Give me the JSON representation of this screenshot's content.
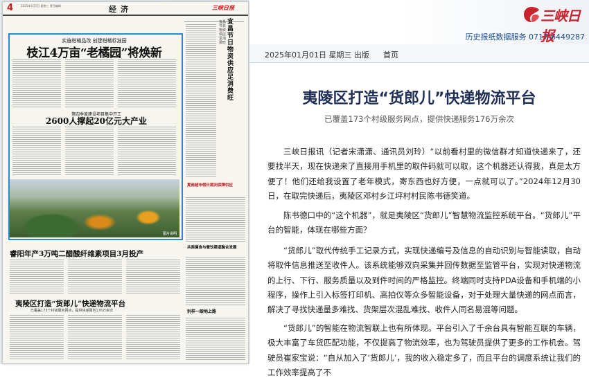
{
  "paper": {
    "page_number": "4",
    "page_meta": "2025年1月1日 星期三 责任编辑",
    "section": "经济",
    "brand": "三峡日报",
    "story_a_kicker": "实施柑橘品改 创建柑橘标准园",
    "story_a_headline": "枝江4万亩“老橘园”将焕新",
    "story_b_kicker": "第四季度建设项目集中开工",
    "story_b_headline": "2600人撑起20亿元大产业",
    "photo_caption": "图片说明",
    "story_c_headline": "睿阳年产3万吨二醋酸纤维素项目3月投产",
    "story_d_headline": "夷陵区打造“货郎儿”快递物流平台",
    "story_d_sub": "已覆盖173个村级服务网点，提供快递服务176万余次",
    "story_e_kicker": "宜昌节日物资供应足消费旺",
    "story_e_headline": "宜昌节日物资供应足消费旺",
    "story_f_headline": "夏商超市假日期间保障供应",
    "story_g_headline": "共商健食与餐饮渠道融合发展",
    "story_h_headline": "别样一眼地上路"
  },
  "header": {
    "logo_text": "三峡日报",
    "archive_link": "历史报纸数据服务  0717-6449287"
  },
  "datebar": {
    "date": "2025年01月01日  星期三  出版",
    "home": "首页"
  },
  "article": {
    "title": "夷陵区打造“货郎儿”快递物流平台",
    "subtitle": "已覆盖173个村级服务网点，提供快递服务176万余次",
    "paragraphs": [
      "三峡日报讯（记者宋潇潇、通讯员刘玲）“以前看村里的微信群才知道快递来了，还要找半天，现在快递来了直接用手机里的取件码就可以取，这个机器还认得我，真是太方便了！他们还给我设置了老年模式，寄东西也好方便，一点就可以了。”2024年12月30日，在取完快递后，夷陵区邓村乡江坪村村民陈书德笑道。",
      "陈书德口中的“这个机器”，就是夷陵区“货郎儿”智慧物流监控系统平台。“货郎儿”平台的智能，体现在哪些方面？",
      "“货郎儿”取代传统手工记录方式，实现快递编号及信息的自动识别与智能读取，自动将取件信息推送至收件人。该系统能够双向采集并回传数据至监管平台，实现对快递物流的上行、下行、服务质量以及到件时间的严格监控。终端同时支持PDA设备和手机端的小程序，操作上引入标签打印机、高拍仪等众多智能设备，对于处理大量快递的网点而言，解决了寻找快递量多难找、货架层次混乱难找、收件人同名易混等问题。",
      "“货郎儿”的智能在物流智联上也有所体现。平台引入了千余台具有智能互联的车辆，极大丰富了车货匹配功能，不仅提高了物流效率，也为驾驶员提供了更多的工作机会。驾驶员崔家宝说：“自从加入了‘货郎儿’，我的收入稳定多了，而且平台的调度系统让我们的工作效率提高了不"
    ]
  },
  "colors": {
    "brand_red": "#c8232c",
    "title_navy": "#1f2f55",
    "link_blue": "#1a4f8a",
    "frame_blue": "#2a86d6"
  }
}
